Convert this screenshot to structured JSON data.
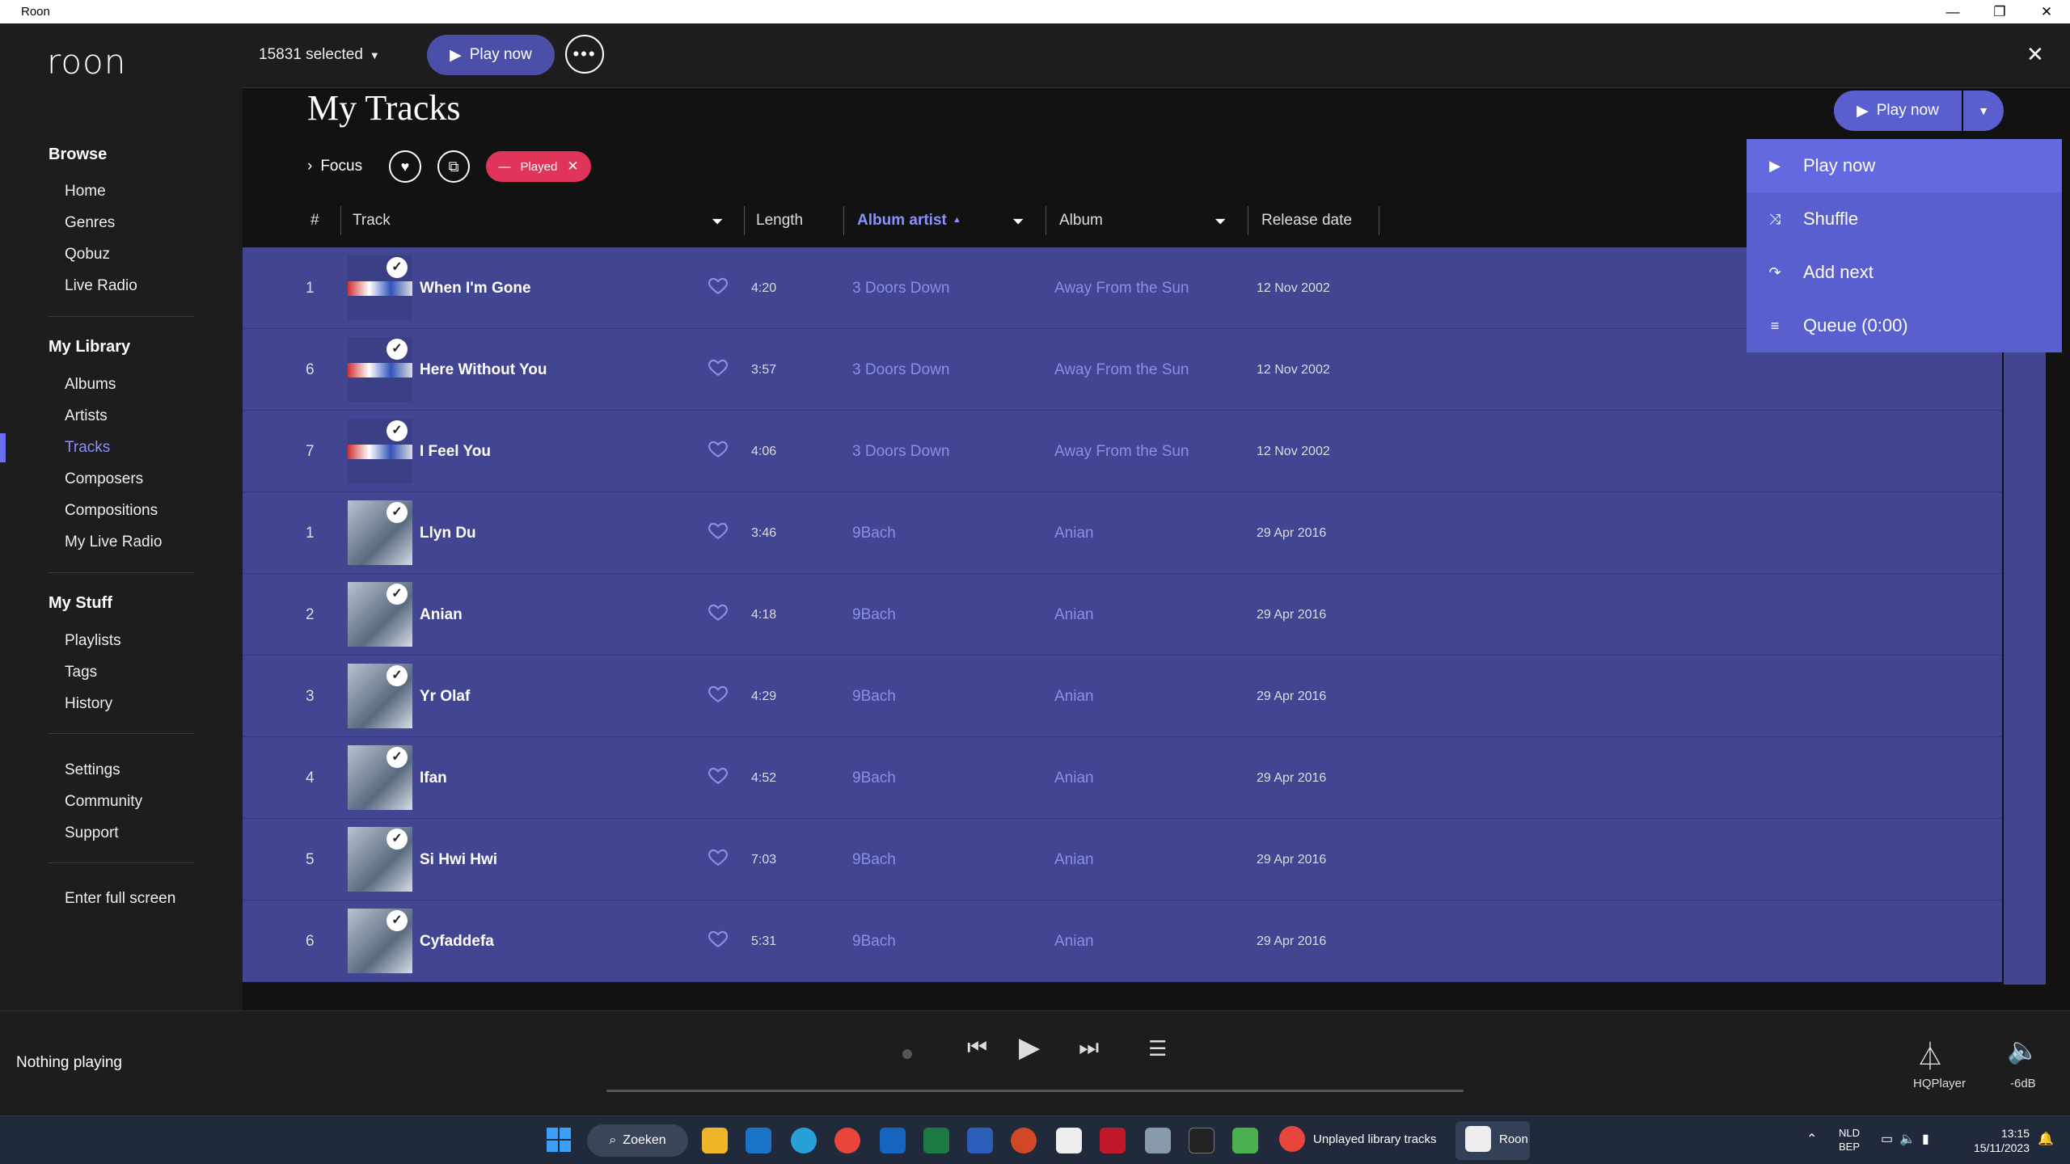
{
  "window": {
    "title": "Roon",
    "minimize": "—",
    "restore": "❐",
    "close": "✕"
  },
  "sidebar": {
    "logo": "roon",
    "browse_title": "Browse",
    "browse": [
      "Home",
      "Genres",
      "Qobuz",
      "Live Radio"
    ],
    "library_title": "My Library",
    "library": [
      "Albums",
      "Artists",
      "Tracks",
      "Composers",
      "Compositions",
      "My Live Radio"
    ],
    "stuff_title": "My Stuff",
    "stuff": [
      "Playlists",
      "Tags",
      "History"
    ],
    "misc": [
      "Settings",
      "Community",
      "Support"
    ],
    "fullscreen": "Enter full screen"
  },
  "topbar": {
    "selected": "15831 selected",
    "play_now": "Play now",
    "close": "✕"
  },
  "page": {
    "title": "My Tracks",
    "focus": "Focus",
    "filter_played": "Played",
    "play_now": "Play now"
  },
  "columns": {
    "num": "#",
    "track": "Track",
    "length": "Length",
    "album_artist": "Album artist",
    "album": "Album",
    "release_date": "Release date"
  },
  "tracks": [
    {
      "num": "1",
      "title": "When I'm Gone",
      "length": "4:20",
      "artist": "3 Doors Down",
      "album": "Away From the Sun",
      "date": "12 Nov 2002",
      "art": "3dd"
    },
    {
      "num": "6",
      "title": "Here Without You",
      "length": "3:57",
      "artist": "3 Doors Down",
      "album": "Away From the Sun",
      "date": "12 Nov 2002",
      "art": "3dd"
    },
    {
      "num": "7",
      "title": "I Feel You",
      "length": "4:06",
      "artist": "3 Doors Down",
      "album": "Away From the Sun",
      "date": "12 Nov 2002",
      "art": "3dd"
    },
    {
      "num": "1",
      "title": "Llyn Du",
      "length": "3:46",
      "artist": "9Bach",
      "album": "Anian",
      "date": "29 Apr 2016",
      "art": "9bach"
    },
    {
      "num": "2",
      "title": "Anian",
      "length": "4:18",
      "artist": "9Bach",
      "album": "Anian",
      "date": "29 Apr 2016",
      "art": "9bach"
    },
    {
      "num": "3",
      "title": "Yr Olaf",
      "length": "4:29",
      "artist": "9Bach",
      "album": "Anian",
      "date": "29 Apr 2016",
      "art": "9bach"
    },
    {
      "num": "4",
      "title": "Ifan",
      "length": "4:52",
      "artist": "9Bach",
      "album": "Anian",
      "date": "29 Apr 2016",
      "art": "9bach"
    },
    {
      "num": "5",
      "title": "Si Hwi Hwi",
      "length": "7:03",
      "artist": "9Bach",
      "album": "Anian",
      "date": "29 Apr 2016",
      "art": "9bach"
    },
    {
      "num": "6",
      "title": "Cyfaddefa",
      "length": "5:31",
      "artist": "9Bach",
      "album": "Anian",
      "date": "29 Apr 2016",
      "art": "9bach"
    }
  ],
  "dropdown": [
    {
      "label": "Play now",
      "icon": "play-icon"
    },
    {
      "label": "Shuffle",
      "icon": "shuffle-icon"
    },
    {
      "label": "Add next",
      "icon": "add-next-icon"
    },
    {
      "label": "Queue (0:00)",
      "icon": "queue-icon"
    }
  ],
  "player": {
    "status": "Nothing playing",
    "zone": "HQPlayer",
    "volume": "-6dB"
  },
  "taskbar": {
    "search": "Zoeken",
    "chrome_tab": "Unplayed library tracks",
    "roon_tab": "Roon",
    "lang1": "NLD",
    "lang2": "BEP",
    "time": "13:15",
    "date": "15/11/2023"
  },
  "colors": {
    "accent": "#4b4fa8",
    "row": "#414592",
    "dropdown": "#5a5fd0",
    "played": "#e0345a"
  }
}
